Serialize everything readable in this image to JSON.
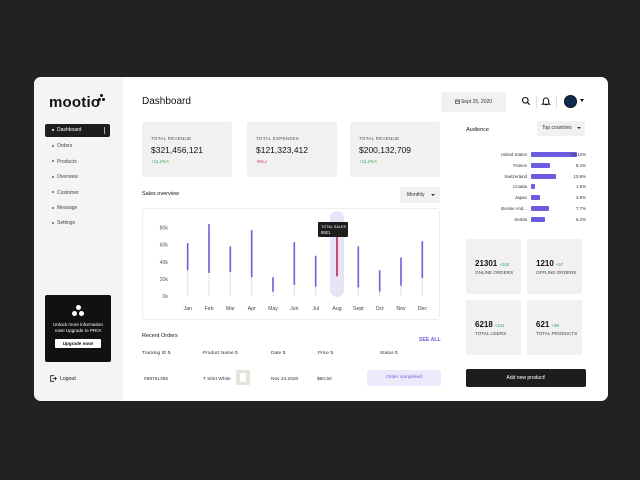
{
  "brand": {
    "name": "mootio"
  },
  "sidebar": {
    "items": [
      {
        "label": "Dashboard",
        "active": true
      },
      {
        "label": "Orders"
      },
      {
        "label": "Products"
      },
      {
        "label": "Overview"
      },
      {
        "label": "Customer"
      },
      {
        "label": "Message"
      },
      {
        "label": "Settings"
      }
    ],
    "promo": {
      "text": "Unlock more information now! Upgrade to PRO!",
      "button": "Upgrade now!"
    },
    "logout": "Logout"
  },
  "header": {
    "title": "Dashboard",
    "date": "Sept 25, 2020",
    "icons": [
      "calendar-icon",
      "search-icon",
      "bell-icon",
      "avatar",
      "chevron-down-icon"
    ]
  },
  "stats": [
    {
      "label": "TOTAL REVENUE",
      "value": "$321,456,121",
      "change": "+11,2%↖",
      "trend": "up"
    },
    {
      "label": "TOTAL EXPENSES",
      "value": "$121,323,412",
      "change": "-5%↙",
      "trend": "down"
    },
    {
      "label": "TOTAL REVENUE",
      "value": "$200,132,709",
      "change": "+11,2%↖",
      "trend": "up"
    }
  ],
  "sales_overview": {
    "title": "Sales overview",
    "period": "Monthly",
    "tooltip": {
      "title": "TOTAL SALES",
      "value": "8921",
      "month": "Aug"
    }
  },
  "chart_data": {
    "type": "bar",
    "title": "Sales overview",
    "categories": [
      "Jan",
      "Feb",
      "Mar",
      "Apr",
      "May",
      "Jun",
      "Jul",
      "Aug",
      "Sept",
      "Oct",
      "Nov",
      "Dec"
    ],
    "series": [
      {
        "low": [
          30000,
          27000,
          28000,
          22000,
          5000,
          13000,
          11000,
          23000,
          10000,
          5000,
          12000,
          21000
        ],
        "high": [
          62000,
          84000,
          58000,
          77000,
          22000,
          63000,
          47000,
          80000,
          58000,
          30000,
          45000,
          64000
        ]
      }
    ],
    "yticks": [
      "0k",
      "20k",
      "40k",
      "60k",
      "80k"
    ],
    "ylim": [
      0,
      90000
    ],
    "highlight": "Aug",
    "colors": {
      "bar": "#6b5ce0",
      "highlight": "#c0264e",
      "highlight_bg": "#e9e3fa"
    }
  },
  "recent_orders": {
    "title": "Recent Orders",
    "see_all": "SEE ALL",
    "columns": [
      "Tracking ID",
      "Product Name",
      "Date",
      "Price",
      "Status"
    ],
    "rows": [
      {
        "id": "#98761356",
        "product": "T Shirt White",
        "date": "Nov 24,2020",
        "price": "$60,50",
        "status": "Order completed"
      }
    ]
  },
  "audience": {
    "title": "Audience",
    "filter": "Top countries",
    "rows": [
      {
        "country": "United States",
        "percent": "20.12%",
        "share": 0.2012
      },
      {
        "country": "France",
        "percent": "8.4%",
        "share": 0.084
      },
      {
        "country": "Switzerland",
        "percent": "10.8%",
        "share": 0.108
      },
      {
        "country": "Croatia",
        "percent": "1.6%",
        "share": 0.016
      },
      {
        "country": "Japan",
        "percent": "3.8%",
        "share": 0.038
      },
      {
        "country": "Bosnie And...",
        "percent": "7.7%",
        "share": 0.077
      },
      {
        "country": "Serbia",
        "percent": "6.2%",
        "share": 0.062
      }
    ]
  },
  "metrics": [
    {
      "value": "21301",
      "change": "+240",
      "label": "ONLINE ORDERS"
    },
    {
      "value": "1210",
      "change": "+57",
      "label": "OFFLINE ORDERS"
    },
    {
      "value": "6218",
      "change": "+241",
      "label": "TOTAL USERS"
    },
    {
      "value": "621",
      "change": "+38",
      "label": "TOTAL PRODUCTS"
    }
  ],
  "actions": {
    "add_product": "Add new product!"
  },
  "colors": {
    "accent": "#6b5ce0",
    "positive": "#2eaa55",
    "negative": "#d9304a",
    "dark": "#1d1d1d"
  }
}
